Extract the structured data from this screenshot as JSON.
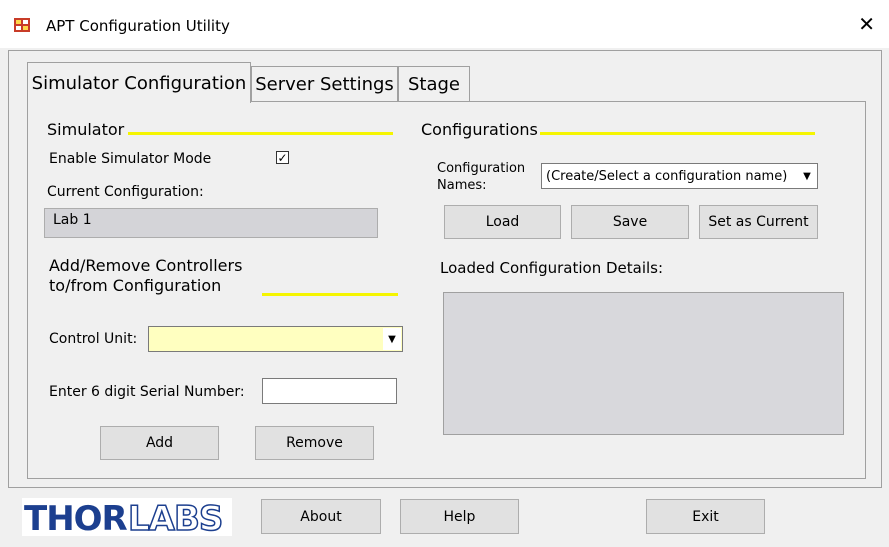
{
  "window": {
    "title": "APT Configuration Utility",
    "close_icon": "close-icon"
  },
  "tabs": [
    {
      "label": "Simulator Configuration",
      "active": true
    },
    {
      "label": "Server Settings",
      "active": false
    },
    {
      "label": "Stage",
      "active": false
    }
  ],
  "simulator": {
    "heading": "Simulator",
    "enable_label": "Enable Simulator Mode",
    "enable_checked_glyph": "✓",
    "current_config_label": "Current Configuration:",
    "current_config_value": "Lab 1"
  },
  "controllers": {
    "heading_line1": "Add/Remove Controllers",
    "heading_line2": "to/from Configuration",
    "control_unit_label": "Control Unit:",
    "control_unit_value": "",
    "serial_label": "Enter 6 digit Serial Number:",
    "serial_value": "",
    "add_label": "Add",
    "remove_label": "Remove"
  },
  "configurations": {
    "heading": "Configurations",
    "names_label_line1": "Configuration",
    "names_label_line2": "Names:",
    "names_selected": "(Create/Select a configuration name)",
    "load_label": "Load",
    "save_label": "Save",
    "set_current_label": "Set as Current",
    "details_label": "Loaded Configuration Details:"
  },
  "footer": {
    "logo_text_left": "THOR",
    "logo_text_right": "LABS",
    "about_label": "About",
    "help_label": "Help",
    "exit_label": "Exit"
  },
  "colors": {
    "accent_yellow": "#f5f500",
    "combo_yellow": "#ffffc0",
    "logo_blue": "#1c3f8f"
  }
}
